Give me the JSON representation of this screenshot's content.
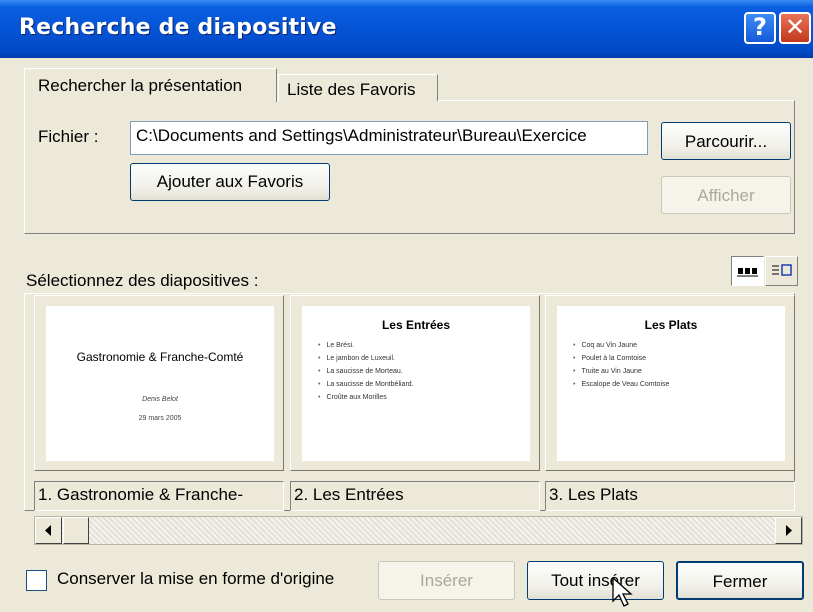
{
  "window": {
    "title": "Recherche de diapositive",
    "help_label": "?",
    "close_label": "✕"
  },
  "tabs": [
    {
      "label": "Rechercher la présentation",
      "active": true
    },
    {
      "label": "Liste des Favoris",
      "active": false
    }
  ],
  "file": {
    "label": "Fichier :",
    "value": "C:\\Documents and Settings\\Administrateur\\Bureau\\Exercice",
    "browse_label": "Parcourir...",
    "add_favorites_label": "Ajouter aux Favoris",
    "show_label": "Afficher"
  },
  "selection": {
    "label": "Sélectionnez des diapositives :"
  },
  "slides": [
    {
      "caption": "1. Gastronomie & Franche-",
      "title": "Gastronomie & Franche-Comté",
      "author": "Denis Belot",
      "date": "29 mars 2005"
    },
    {
      "caption": "2. Les Entrées",
      "title": "Les Entrées",
      "bullets": [
        "Le Brési.",
        "Le jambon de Luxeuil.",
        "La saucisse de Morteau.",
        "La saucisse de Montbéliard.",
        "Croûte aux Morilles"
      ]
    },
    {
      "caption": "3. Les Plats",
      "title": "Les Plats",
      "bullets": [
        "Coq au Vin Jaune",
        "Poulet à la Comtoise",
        "Truite au Vin Jaune",
        "Escalope de Veau Comtoise"
      ]
    }
  ],
  "footer": {
    "keep_format_label": "Conserver la mise en forme d'origine",
    "keep_format_checked": false,
    "insert_label": "Insérer",
    "insert_all_label": "Tout insérer",
    "close_label": "Fermer"
  },
  "colors": {
    "titlebar": "#0654d6",
    "dialog_bg": "#ece9d8",
    "button_border": "#003c74"
  }
}
